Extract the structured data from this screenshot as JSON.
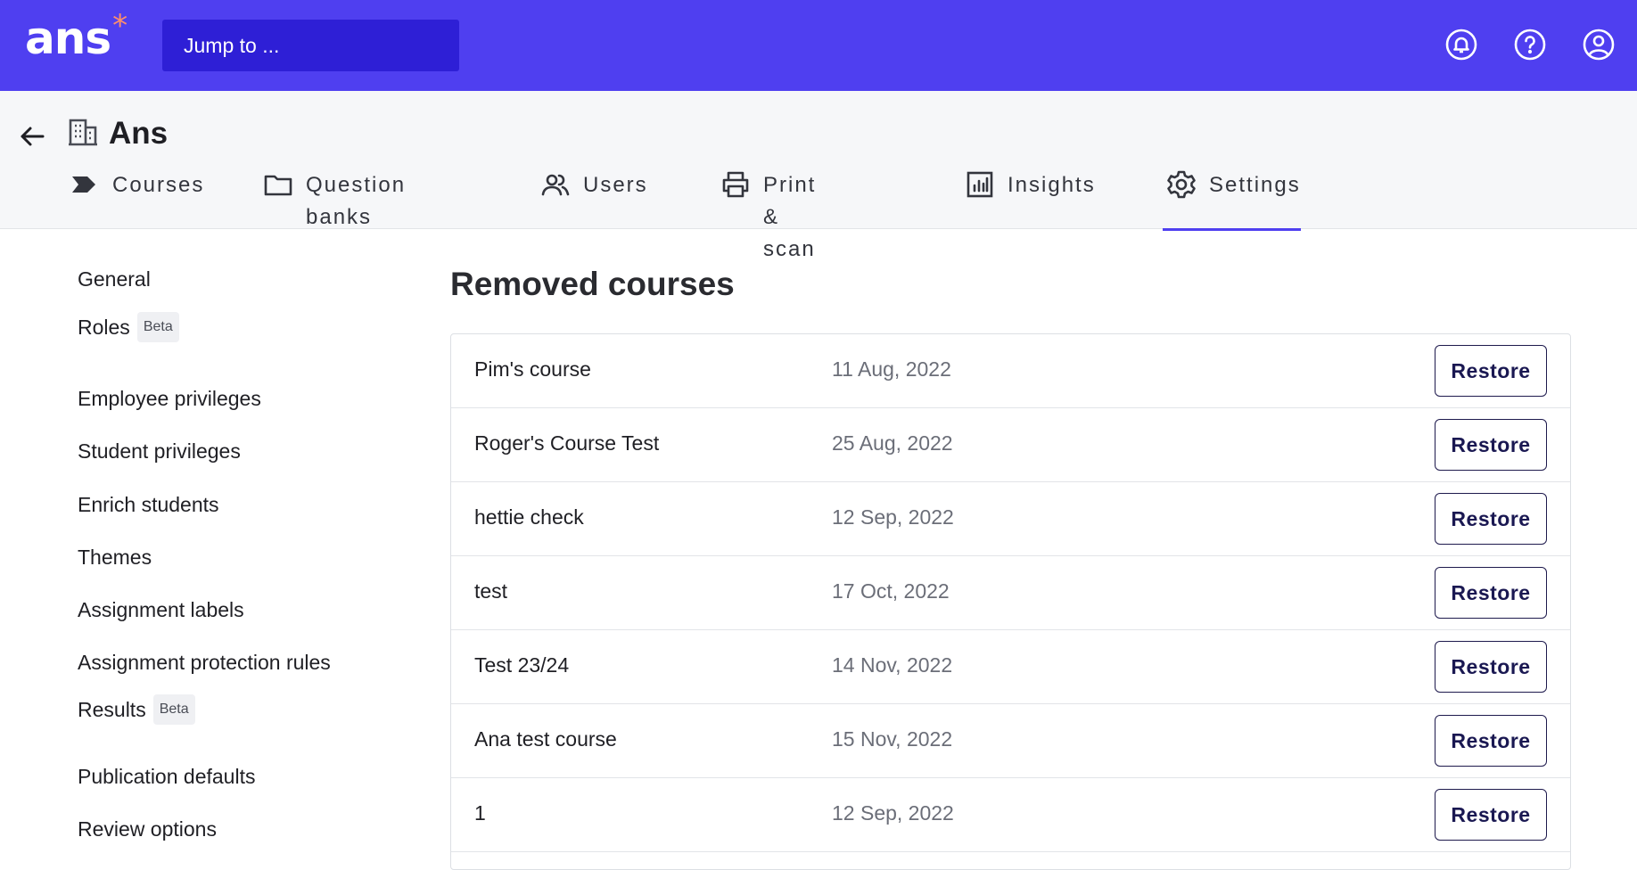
{
  "app": {
    "logo_text": "ans",
    "logo_mark": "*",
    "search_placeholder": "Jump to ...",
    "top_icons": [
      "notifications-icon",
      "help-icon",
      "account-icon"
    ],
    "colors": {
      "brand": "#4f3ff0",
      "search_bg": "#2e1fd6",
      "accent_star": "#ff8f6b"
    }
  },
  "header": {
    "org_name": "Ans",
    "tabs": [
      {
        "label": "Courses",
        "icon": "tag-icon"
      },
      {
        "label": "Question banks",
        "icon": "folder-icon"
      },
      {
        "label": "Users",
        "icon": "users-icon"
      },
      {
        "label": "Print & scan",
        "icon": "printer-icon"
      },
      {
        "label": "Insights",
        "icon": "chart-icon"
      },
      {
        "label": "Settings",
        "icon": "gear-icon",
        "active": true
      }
    ]
  },
  "sidebar": {
    "items": [
      {
        "label": "General"
      },
      {
        "label": "Roles",
        "badge": "Beta"
      },
      {
        "label": "Employee privileges"
      },
      {
        "label": "Student privileges"
      },
      {
        "label": "Enrich students"
      },
      {
        "label": "Themes"
      },
      {
        "label": "Assignment labels"
      },
      {
        "label": "Assignment protection rules"
      },
      {
        "label": "Results",
        "badge": "Beta"
      },
      {
        "label": "Publication defaults"
      },
      {
        "label": "Review options"
      }
    ]
  },
  "main": {
    "title": "Removed courses",
    "restore_label": "Restore",
    "rows": [
      {
        "course": "Pim's course",
        "date": "11 Aug, 2022"
      },
      {
        "course": "Roger's Course Test",
        "date": "25 Aug, 2022"
      },
      {
        "course": "hettie check",
        "date": "12 Sep, 2022"
      },
      {
        "course": "test",
        "date": "17 Oct, 2022"
      },
      {
        "course": "Test 23/24",
        "date": "14 Nov, 2022"
      },
      {
        "course": "Ana test course",
        "date": "15 Nov, 2022"
      },
      {
        "course": "1",
        "date": "12 Sep, 2022"
      }
    ]
  }
}
